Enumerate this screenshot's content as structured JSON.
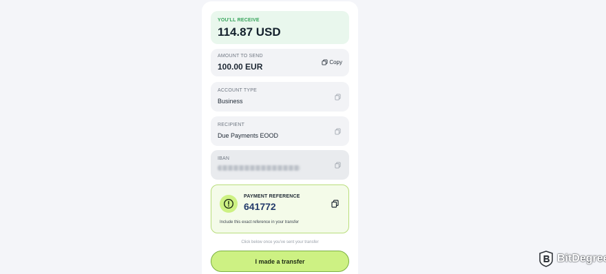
{
  "receive": {
    "label": "YOU'LL RECEIVE",
    "amount": "114.87 USD"
  },
  "send": {
    "label": "AMOUNT TO SEND",
    "amount": "100.00 EUR",
    "copy_label": "Copy"
  },
  "account_type": {
    "label": "ACCOUNT TYPE",
    "value": "Business"
  },
  "recipient": {
    "label": "RECIPIENT",
    "value": "Due Payments EOOD"
  },
  "iban": {
    "label": "IBAN"
  },
  "payment_reference": {
    "label": "PAYMENT REFERENCE",
    "value": "641772",
    "note": "Include this exact reference in your transfer",
    "icon": "alert-circle-icon"
  },
  "hint": "Click below once you've sent your transfer",
  "cta_label": "I made a transfer",
  "watermark": {
    "name": "BitDegree"
  },
  "colors": {
    "accent": "#cdf183",
    "receive_green": "#35a35a",
    "reference_blue": "#223a6a"
  }
}
